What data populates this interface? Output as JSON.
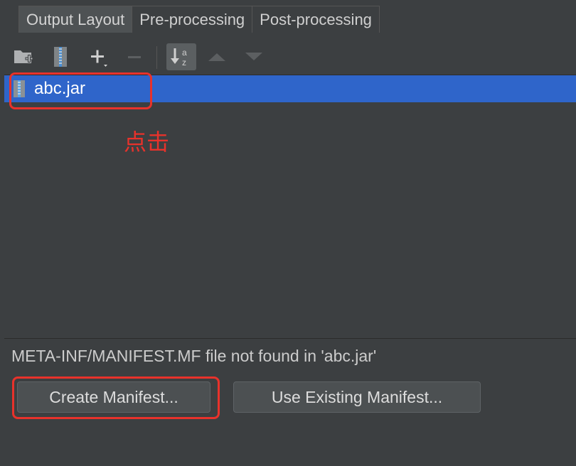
{
  "tabs": [
    {
      "label": "Output Layout",
      "active": true
    },
    {
      "label": "Pre-processing",
      "active": false
    },
    {
      "label": "Post-processing",
      "active": false
    }
  ],
  "toolbar": {
    "icons": [
      "new-folder-icon",
      "archive-icon",
      "add-icon",
      "remove-icon",
      "sort-alphabetically-icon",
      "move-up-icon",
      "move-down-icon"
    ]
  },
  "tree": {
    "items": [
      {
        "label": "abc.jar",
        "icon": "jar-archive-icon",
        "selected": true
      }
    ]
  },
  "annotation": {
    "text": "点击",
    "color": "#e8322b"
  },
  "manifest": {
    "status": "META-INF/MANIFEST.MF file not found in 'abc.jar'",
    "create_label": "Create Manifest...",
    "use_existing_label": "Use Existing Manifest..."
  },
  "colors": {
    "background": "#3c3f41",
    "selection": "#2f65ca",
    "highlight": "#e8322b"
  }
}
